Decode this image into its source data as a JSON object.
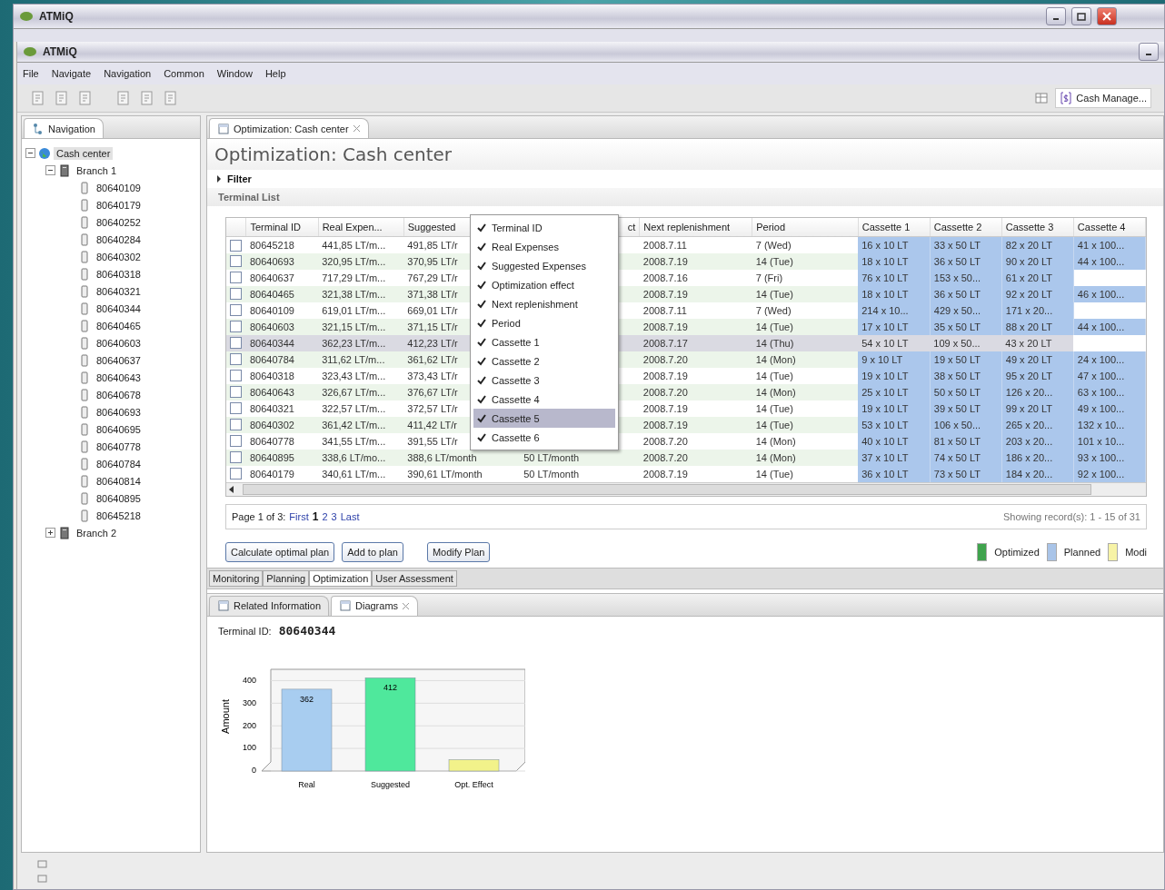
{
  "outer_window": {
    "title": "ATMiQ"
  },
  "window": {
    "title": "ATMiQ",
    "menu": [
      "File",
      "Navigate",
      "Navigation",
      "Common",
      "Window",
      "Help"
    ],
    "perspective": "Cash Manage..."
  },
  "navigation": {
    "tab": "Navigation",
    "tree": [
      {
        "label": "Cash center",
        "kind": "root",
        "selected": true,
        "expanded": true,
        "children": [
          {
            "label": "Branch 1",
            "kind": "branch",
            "selected": false,
            "expanded": true,
            "children": [
              {
                "label": "80640109",
                "kind": "terminal",
                "selected": false
              },
              {
                "label": "80640179",
                "kind": "terminal",
                "selected": false
              },
              {
                "label": "80640252",
                "kind": "terminal",
                "selected": false
              },
              {
                "label": "80640284",
                "kind": "terminal",
                "selected": false
              },
              {
                "label": "80640302",
                "kind": "terminal",
                "selected": false
              },
              {
                "label": "80640318",
                "kind": "terminal",
                "selected": false
              },
              {
                "label": "80640321",
                "kind": "terminal",
                "selected": false
              },
              {
                "label": "80640344",
                "kind": "terminal",
                "selected": false
              },
              {
                "label": "80640465",
                "kind": "terminal",
                "selected": false
              },
              {
                "label": "80640603",
                "kind": "terminal",
                "selected": false
              },
              {
                "label": "80640637",
                "kind": "terminal",
                "selected": false
              },
              {
                "label": "80640643",
                "kind": "terminal",
                "selected": false
              },
              {
                "label": "80640678",
                "kind": "terminal",
                "selected": false
              },
              {
                "label": "80640693",
                "kind": "terminal",
                "selected": false
              },
              {
                "label": "80640695",
                "kind": "terminal",
                "selected": false
              },
              {
                "label": "80640778",
                "kind": "terminal",
                "selected": false
              },
              {
                "label": "80640784",
                "kind": "terminal",
                "selected": false
              },
              {
                "label": "80640814",
                "kind": "terminal",
                "selected": false
              },
              {
                "label": "80640895",
                "kind": "terminal",
                "selected": false
              },
              {
                "label": "80645218",
                "kind": "terminal",
                "selected": false
              }
            ]
          },
          {
            "label": "Branch 2",
            "kind": "branch",
            "selected": false,
            "expanded": false
          }
        ]
      }
    ]
  },
  "editor": {
    "tab": "Optimization: Cash center",
    "title": "Optimization: Cash center",
    "filter": {
      "label": "Filter",
      "expanded": false
    },
    "section": "Terminal List",
    "table": {
      "columns": [
        "Terminal ID",
        "Real Expen...",
        "Suggested",
        "ct",
        "Next replenishment",
        "Period",
        "Cassette 1",
        "Cassette 2",
        "Cassette 3",
        "Cassette 4"
      ],
      "rows": [
        {
          "checked": false,
          "selected": false,
          "terminal_id": "80645218",
          "real": "441,85 LT/m...",
          "suggested": "491,85 LT/r",
          "next": "2008.7.11",
          "period": "7 (Wed)",
          "cassettes": [
            "16 x 10 LT",
            "33 x 50 LT",
            "82 x 20 LT",
            "41 x 100..."
          ]
        },
        {
          "checked": false,
          "selected": false,
          "terminal_id": "80640693",
          "real": "320,95 LT/m...",
          "suggested": "370,95 LT/r",
          "next": "2008.7.19",
          "period": "14 (Tue)",
          "cassettes": [
            "18 x 10 LT",
            "36 x 50 LT",
            "90 x 20 LT",
            "44 x 100..."
          ]
        },
        {
          "checked": false,
          "selected": false,
          "terminal_id": "80640637",
          "real": "717,29 LT/m...",
          "suggested": "767,29 LT/r",
          "next": "2008.7.16",
          "period": "7 (Fri)",
          "cassettes": [
            "76 x 10 LT",
            "153 x 50...",
            "61 x 20 LT"
          ]
        },
        {
          "checked": false,
          "selected": false,
          "terminal_id": "80640465",
          "real": "321,38 LT/m...",
          "suggested": "371,38 LT/r",
          "next": "2008.7.19",
          "period": "14 (Tue)",
          "cassettes": [
            "18 x 10 LT",
            "36 x 50 LT",
            "92 x 20 LT",
            "46 x 100..."
          ]
        },
        {
          "checked": false,
          "selected": false,
          "terminal_id": "80640109",
          "real": "619,01 LT/m...",
          "suggested": "669,01 LT/r",
          "next": "2008.7.11",
          "period": "7 (Wed)",
          "cassettes": [
            "214 x 10...",
            "429 x 50...",
            "171 x 20..."
          ]
        },
        {
          "checked": false,
          "selected": false,
          "terminal_id": "80640603",
          "real": "321,15 LT/m...",
          "suggested": "371,15 LT/r",
          "next": "2008.7.19",
          "period": "14 (Tue)",
          "cassettes": [
            "17 x 10 LT",
            "35 x 50 LT",
            "88 x 20 LT",
            "44 x 100..."
          ]
        },
        {
          "checked": false,
          "selected": true,
          "terminal_id": "80640344",
          "real": "362,23 LT/m...",
          "suggested": "412,23 LT/r",
          "next": "2008.7.17",
          "period": "14 (Thu)",
          "cassettes": [
            "54 x 10 LT",
            "109 x 50...",
            "43 x 20 LT"
          ]
        },
        {
          "checked": false,
          "selected": false,
          "terminal_id": "80640784",
          "real": "311,62 LT/m...",
          "suggested": "361,62 LT/r",
          "next": "2008.7.20",
          "period": "14 (Mon)",
          "cassettes": [
            "9 x 10 LT",
            "19 x 50 LT",
            "49 x 20 LT",
            "24 x 100..."
          ]
        },
        {
          "checked": false,
          "selected": false,
          "terminal_id": "80640318",
          "real": "323,43 LT/m...",
          "suggested": "373,43 LT/r",
          "next": "2008.7.19",
          "period": "14 (Tue)",
          "cassettes": [
            "19 x 10 LT",
            "38 x 50 LT",
            "95 x 20 LT",
            "47 x 100..."
          ]
        },
        {
          "checked": false,
          "selected": false,
          "terminal_id": "80640643",
          "real": "326,67 LT/m...",
          "suggested": "376,67 LT/r",
          "next": "2008.7.20",
          "period": "14 (Mon)",
          "cassettes": [
            "25 x 10 LT",
            "50 x 50 LT",
            "126 x 20...",
            "63 x 100..."
          ]
        },
        {
          "checked": false,
          "selected": false,
          "terminal_id": "80640321",
          "real": "322,57 LT/m...",
          "suggested": "372,57 LT/r",
          "next": "2008.7.19",
          "period": "14 (Tue)",
          "cassettes": [
            "19 x 10 LT",
            "39 x 50 LT",
            "99 x 20 LT",
            "49 x 100..."
          ]
        },
        {
          "checked": false,
          "selected": false,
          "terminal_id": "80640302",
          "real": "361,42 LT/m...",
          "suggested": "411,42 LT/r",
          "next": "2008.7.19",
          "period": "14 (Tue)",
          "cassettes": [
            "53 x 10 LT",
            "106 x 50...",
            "265 x 20...",
            "132 x 10..."
          ]
        },
        {
          "checked": false,
          "selected": false,
          "terminal_id": "80640778",
          "real": "341,55 LT/m...",
          "suggested": "391,55 LT/r",
          "next": "2008.7.20",
          "period": "14 (Mon)",
          "cassettes": [
            "40 x 10 LT",
            "81 x 50 LT",
            "203 x 20...",
            "101 x 10..."
          ]
        },
        {
          "checked": false,
          "selected": false,
          "terminal_id": "80640895",
          "real": "338,6 LT/mo...",
          "suggested": "388,6 LT/month",
          "effect": "50 LT/month",
          "next": "2008.7.20",
          "period": "14 (Mon)",
          "cassettes": [
            "37 x 10 LT",
            "74 x 50 LT",
            "186 x 20...",
            "93 x 100..."
          ]
        },
        {
          "checked": false,
          "selected": false,
          "terminal_id": "80640179",
          "real": "340,61 LT/m...",
          "suggested": "390,61 LT/month",
          "effect": "50 LT/month",
          "next": "2008.7.19",
          "period": "14 (Tue)",
          "cassettes": [
            "36 x 10 LT",
            "73 x 50 LT",
            "184 x 20...",
            "92 x 100..."
          ]
        }
      ]
    },
    "column_menu": {
      "items": [
        {
          "label": "Terminal ID",
          "checked": true,
          "selected": false
        },
        {
          "label": "Real Expenses",
          "checked": true,
          "selected": false
        },
        {
          "label": "Suggested Expenses",
          "checked": true,
          "selected": false
        },
        {
          "label": "Optimization effect",
          "checked": true,
          "selected": false
        },
        {
          "label": "Next replenishment",
          "checked": true,
          "selected": false
        },
        {
          "label": "Period",
          "checked": true,
          "selected": false
        },
        {
          "label": "Cassette 1",
          "checked": true,
          "selected": false
        },
        {
          "label": "Cassette 2",
          "checked": true,
          "selected": false
        },
        {
          "label": "Cassette 3",
          "checked": true,
          "selected": false
        },
        {
          "label": "Cassette 4",
          "checked": true,
          "selected": false
        },
        {
          "label": "Cassette 5",
          "checked": true,
          "selected": true
        },
        {
          "label": "Cassette 6",
          "checked": true,
          "selected": false
        }
      ]
    },
    "pagination": {
      "prefix": "Page 1 of 3:",
      "links": [
        {
          "label": "First",
          "current": false
        },
        {
          "label": "1",
          "current": true
        },
        {
          "label": "2",
          "current": false
        },
        {
          "label": "3",
          "current": false
        },
        {
          "label": "Last",
          "current": false
        }
      ],
      "summary": "Showing record(s): 1 - 15 of 31"
    },
    "buttons": [
      "Calculate optimal plan",
      "Add to plan",
      "Modify Plan"
    ],
    "legend": [
      {
        "label": "Optimized",
        "color": "#3fa34d"
      },
      {
        "label": "Planned",
        "color": "#a9c4e8"
      },
      {
        "label": "Modi",
        "color": "#f7f3a6"
      }
    ],
    "perspective_tabs": [
      {
        "label": "Monitoring",
        "selected": false
      },
      {
        "label": "Planning",
        "selected": false
      },
      {
        "label": "Optimization",
        "selected": true
      },
      {
        "label": "User Assessment",
        "selected": false
      }
    ]
  },
  "views": {
    "tabs": [
      {
        "label": "Related Information",
        "selected": false
      },
      {
        "label": "Diagrams",
        "selected": true
      }
    ],
    "terminal_label": "Terminal ID:",
    "terminal_value": "80640344",
    "chart_data": {
      "type": "bar",
      "ylabel": "Amount",
      "grid": true,
      "series": [
        {
          "name": "Real",
          "color": "#a8cdf0",
          "values": [
            362,
            null,
            null
          ]
        },
        {
          "name": "Suggested",
          "color": "#4fe89c",
          "values": [
            null,
            412,
            null
          ]
        },
        {
          "name": "Opt. Effect",
          "color": "#f2f28a",
          "values": [
            null,
            null,
            50
          ]
        }
      ],
      "ylim": [
        0,
        450
      ],
      "yticks": [
        0,
        100,
        200,
        300,
        400
      ],
      "value_labels": [
        "362",
        "412",
        null
      ]
    }
  }
}
